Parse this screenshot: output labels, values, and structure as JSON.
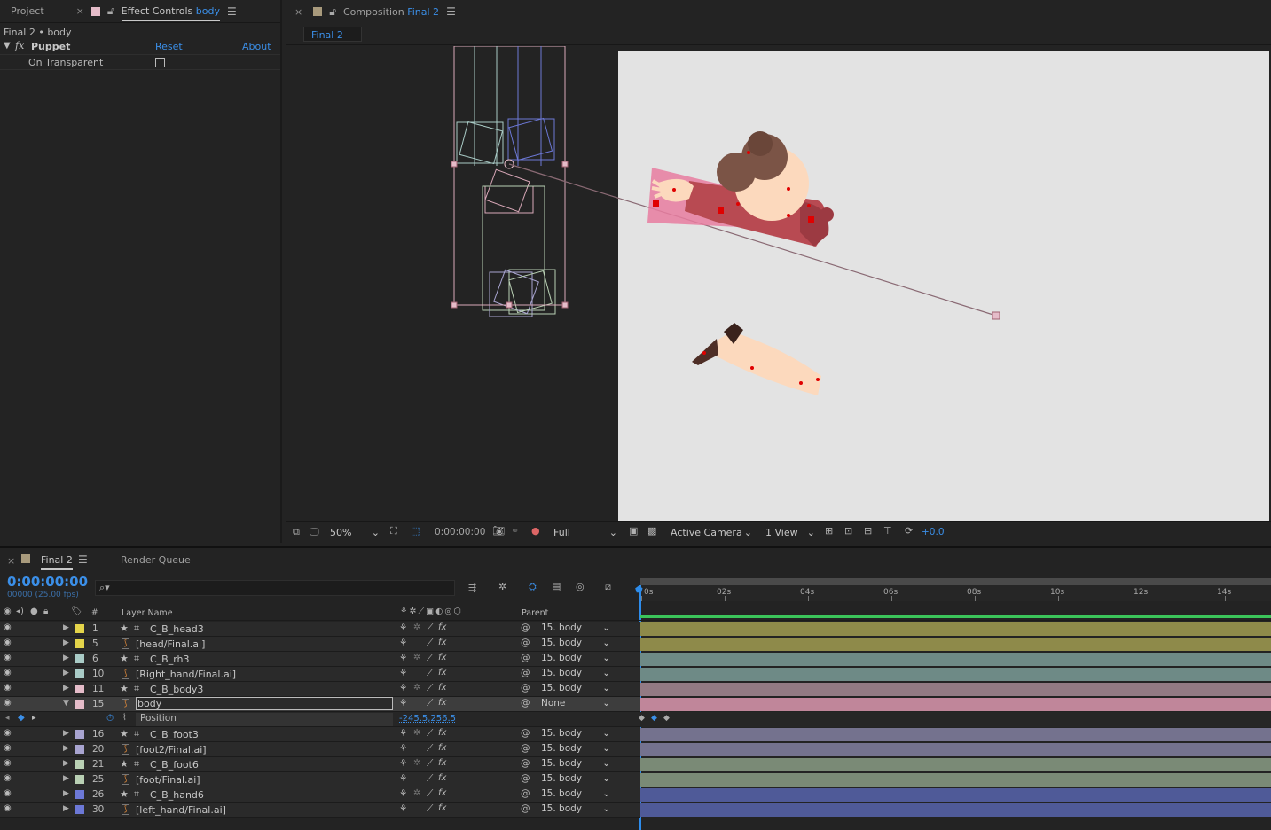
{
  "effects_panel": {
    "tab_project": "Project",
    "tab_effect_controls": "Effect Controls",
    "tab_effect_layer": "body",
    "breadcrumb": "Final 2 • body",
    "effect_name": "Puppet",
    "reset_label": "Reset",
    "about_label": "About",
    "prop_on_transparent": "On Transparent"
  },
  "comp_panel": {
    "tab_title": "Composition",
    "tab_comp": "Final 2",
    "sub_tab": "Final 2",
    "zoom": "50%",
    "timecode": "0:00:00:00",
    "resolution": "Full",
    "camera": "Active Camera",
    "views": "1 View",
    "exposure": "+0.0"
  },
  "timeline": {
    "tab_comp": "Final 2",
    "tab_render_queue": "Render Queue",
    "current_time": "0:00:00:00",
    "frame_info": "00000 (25.00 fps)",
    "col_number": "#",
    "col_layer_name": "Layer Name",
    "col_parent": "Parent",
    "ruler": [
      "0s",
      "02s",
      "04s",
      "06s",
      "08s",
      "10s",
      "12s",
      "14s"
    ],
    "position_label": "Position",
    "position_value": "-245.5,256.5",
    "layers": [
      {
        "num": "1",
        "name": "C_B_head3",
        "kind": "null",
        "color": "#e4d44a",
        "parent": "15. body",
        "bar": "#8e8a4a"
      },
      {
        "num": "5",
        "name": "[head/Final.ai]",
        "kind": "ai",
        "color": "#e4d44a",
        "parent": "15. body",
        "bar": "#8e8a4a"
      },
      {
        "num": "6",
        "name": "C_B_rh3",
        "kind": "null",
        "color": "#a9cbc6",
        "parent": "15. body",
        "bar": "#6e8a86"
      },
      {
        "num": "10",
        "name": "[Right_hand/Final.ai]",
        "kind": "ai",
        "color": "#a9cbc6",
        "parent": "15. body",
        "bar": "#6e8a86"
      },
      {
        "num": "11",
        "name": "C_B_body3",
        "kind": "null",
        "color": "#e5bcc9",
        "parent": "15. body",
        "bar": "#927a83"
      },
      {
        "num": "15",
        "name": "body",
        "kind": "ai",
        "color": "#e5bcc9",
        "parent": "None",
        "bar": "#c0869a"
      },
      {
        "num": "16",
        "name": "C_B_foot3",
        "kind": "null",
        "color": "#a8a4d0",
        "parent": "15. body",
        "bar": "#74728e"
      },
      {
        "num": "20",
        "name": "[foot2/Final.ai]",
        "kind": "ai",
        "color": "#a8a4d0",
        "parent": "15. body",
        "bar": "#74728e"
      },
      {
        "num": "21",
        "name": "C_B_foot6",
        "kind": "null",
        "color": "#b9d0b4",
        "parent": "15. body",
        "bar": "#7a8a76"
      },
      {
        "num": "25",
        "name": "[foot/Final.ai]",
        "kind": "ai",
        "color": "#b9d0b4",
        "parent": "15. body",
        "bar": "#7a8a76"
      },
      {
        "num": "26",
        "name": "C_B_hand6",
        "kind": "null",
        "color": "#6c78d6",
        "parent": "15. body",
        "bar": "#4f5a98"
      },
      {
        "num": "30",
        "name": "[left_hand/Final.ai]",
        "kind": "ai",
        "color": "#6c78d6",
        "parent": "15. body",
        "bar": "#4f5a98"
      }
    ]
  }
}
